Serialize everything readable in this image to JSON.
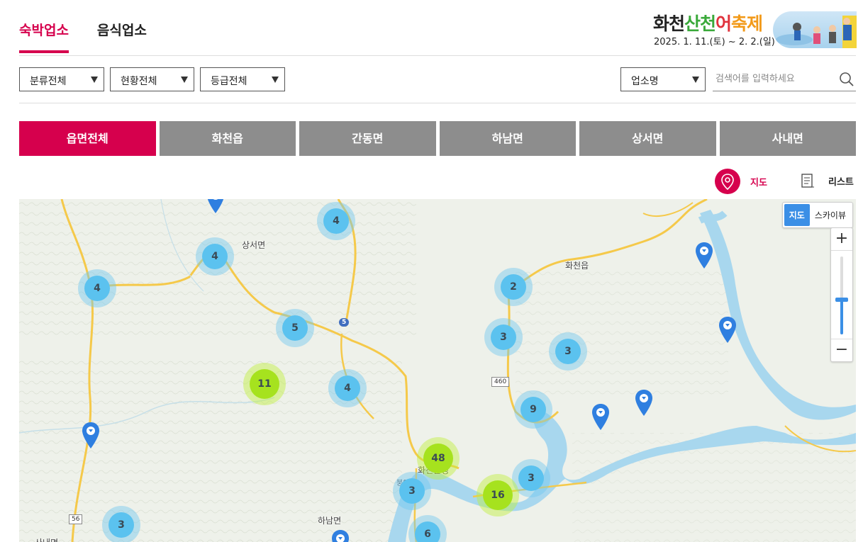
{
  "top_tabs": [
    {
      "label": "숙박업소",
      "active": true
    },
    {
      "label": "음식업소",
      "active": false
    }
  ],
  "banner": {
    "title_part1": "화천",
    "title_part2": "산천",
    "title_part3": "어",
    "title_part4": "축제",
    "date": "2025. 1. 11.(토) ~ 2. 2.(일)"
  },
  "filters": {
    "category": "분류전체",
    "status": "현황전체",
    "grade": "등급전체"
  },
  "search": {
    "field": "업소명",
    "placeholder": "검색어를 입력하세요"
  },
  "districts": [
    {
      "label": "읍면전체",
      "active": true
    },
    {
      "label": "화천읍",
      "active": false
    },
    {
      "label": "간동면",
      "active": false
    },
    {
      "label": "하남면",
      "active": false
    },
    {
      "label": "상서면",
      "active": false
    },
    {
      "label": "사내면",
      "active": false
    }
  ],
  "view": {
    "map_label": "지도",
    "list_label": "리스트"
  },
  "map": {
    "type_map": "지도",
    "type_sky": "스카이뷰",
    "zoom_in": "+",
    "zoom_out": "−",
    "zoom_level_fraction": 0.45,
    "places": {
      "sangseo": "상서면",
      "hwacheon": "화천읍",
      "county": "화천군청",
      "hanam": "하남면",
      "sanae": "사내면",
      "bung": "붕어섬"
    },
    "roads": {
      "r5": "5",
      "r460": "460",
      "r56": "56"
    },
    "clusters": {
      "c1": "4",
      "c2": "4",
      "c3": "4",
      "c4": "5",
      "c5": "2",
      "c6": "3",
      "c7": "3",
      "c8": "11",
      "c9": "4",
      "c10": "9",
      "c11": "48",
      "c12": "3",
      "c13": "3",
      "c14": "16",
      "c15": "3",
      "c16": "6"
    },
    "colors": {
      "cluster_small": "#5bc2ef",
      "cluster_large": "#a6e21e",
      "water": "#a8d7ee",
      "road": "#f5c94a",
      "marker": "#2f7fe0"
    }
  }
}
